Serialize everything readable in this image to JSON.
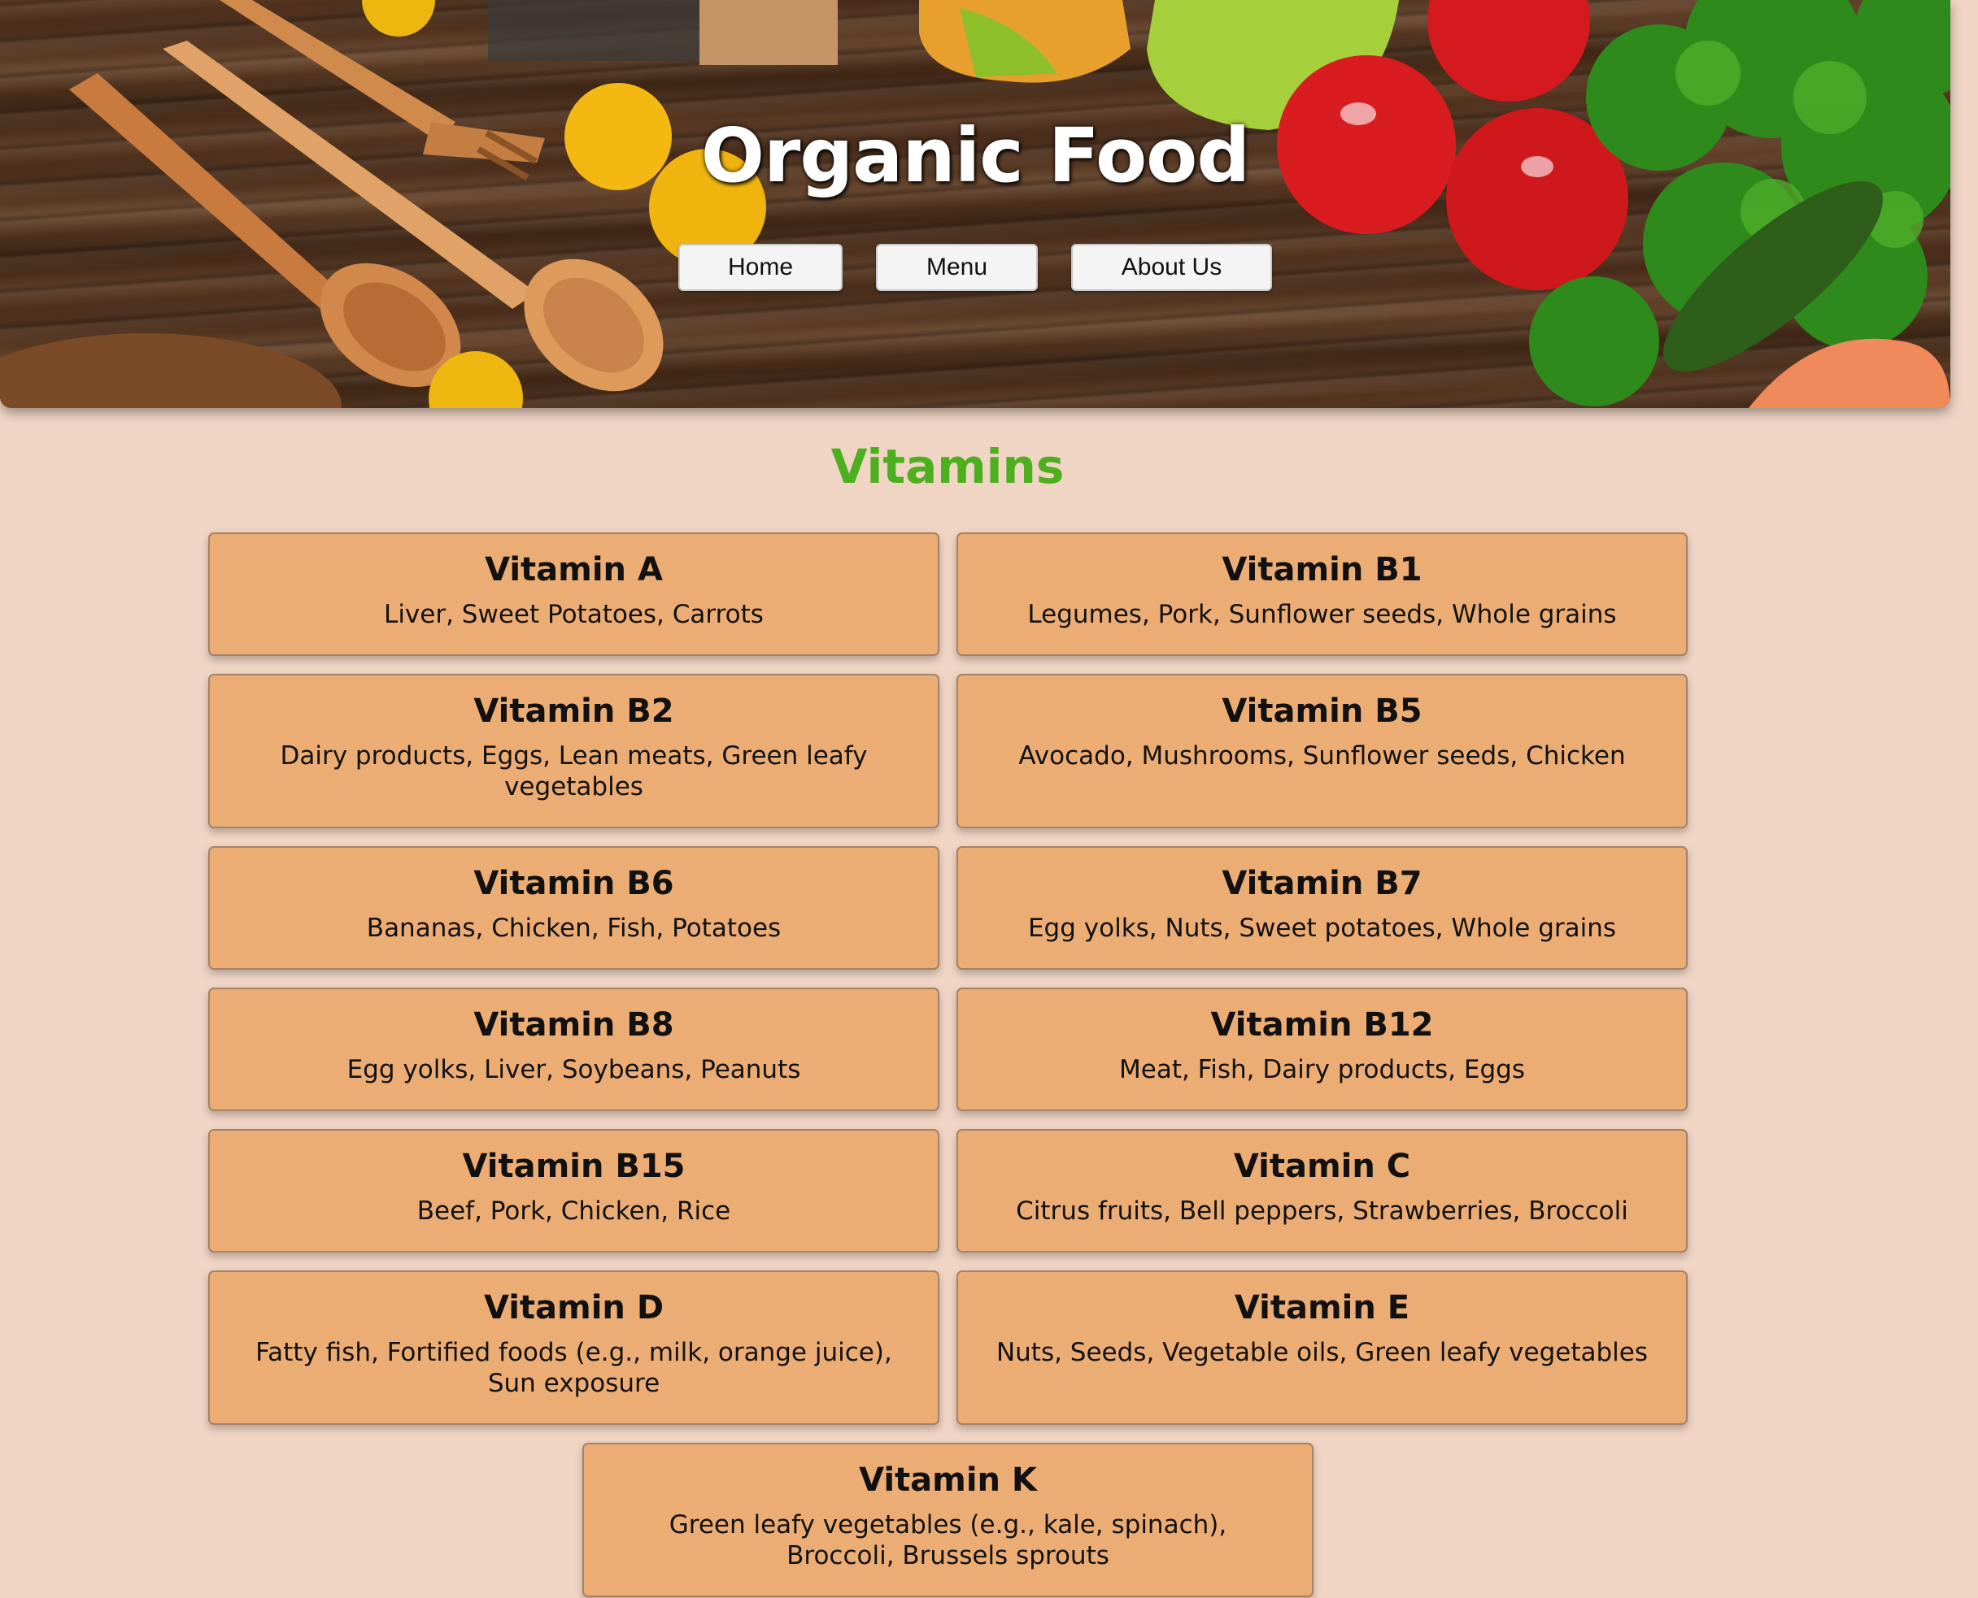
{
  "header": {
    "title": "Organic Food",
    "nav": [
      {
        "label": "Home"
      },
      {
        "label": "Menu"
      },
      {
        "label": "About Us"
      }
    ]
  },
  "main": {
    "heading": "Vitamins",
    "heading_color": "#4caf1e",
    "card_color": "#ecad75",
    "vitamins": [
      {
        "name": "Vitamin A",
        "sources": "Liver, Sweet Potatoes, Carrots"
      },
      {
        "name": "Vitamin B1",
        "sources": "Legumes, Pork, Sunflower seeds, Whole grains"
      },
      {
        "name": "Vitamin B2",
        "sources": "Dairy products, Eggs, Lean meats, Green leafy vegetables"
      },
      {
        "name": "Vitamin B5",
        "sources": "Avocado, Mushrooms, Sunflower seeds, Chicken"
      },
      {
        "name": "Vitamin B6",
        "sources": "Bananas, Chicken, Fish, Potatoes"
      },
      {
        "name": "Vitamin B7",
        "sources": "Egg yolks, Nuts, Sweet potatoes, Whole grains"
      },
      {
        "name": "Vitamin B8",
        "sources": "Egg yolks, Liver, Soybeans, Peanuts"
      },
      {
        "name": "Vitamin B12",
        "sources": "Meat, Fish, Dairy products, Eggs"
      },
      {
        "name": "Vitamin B15",
        "sources": "Beef, Pork, Chicken, Rice"
      },
      {
        "name": "Vitamin C",
        "sources": "Citrus fruits, Bell peppers, Strawberries, Broccoli"
      },
      {
        "name": "Vitamin D",
        "sources": "Fatty fish, Fortified foods (e.g., milk, orange juice), Sun exposure"
      },
      {
        "name": "Vitamin E",
        "sources": "Nuts, Seeds, Vegetable oils, Green leafy vegetables"
      },
      {
        "name": "Vitamin K",
        "sources": "Green leafy vegetables (e.g., kale, spinach), Broccoli, Brussels sprouts"
      }
    ]
  }
}
